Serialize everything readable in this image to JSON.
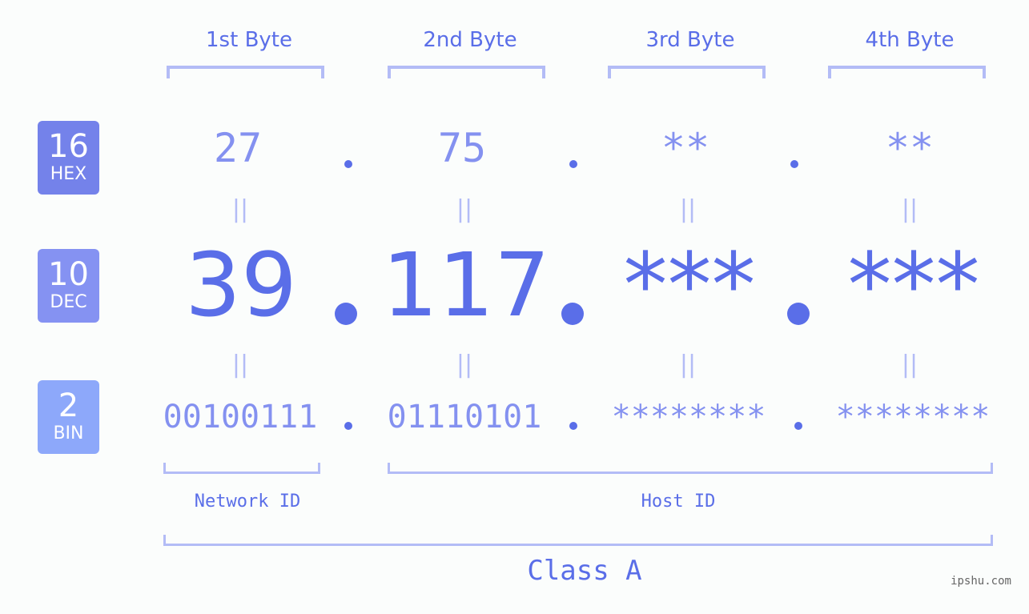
{
  "colors": {
    "accent": "#5a6ee8",
    "light": "#8491f0",
    "bracket": "#b3bcf6",
    "hex_badge": "#7482ea",
    "dec_badge": "#8592f2",
    "bin_badge": "#8da8fa"
  },
  "badges": [
    {
      "num": "16",
      "label": "HEX"
    },
    {
      "num": "10",
      "label": "DEC"
    },
    {
      "num": "2",
      "label": "BIN"
    }
  ],
  "byte_titles": [
    "1st Byte",
    "2nd Byte",
    "3rd Byte",
    "4th Byte"
  ],
  "hex": [
    "27",
    "75",
    "**",
    "**"
  ],
  "dec": [
    "39",
    "117",
    "***",
    "***"
  ],
  "bin": [
    "00100111",
    "01110101",
    "********",
    "********"
  ],
  "equals_sign": "||",
  "network_id_label": "Network ID",
  "host_id_label": "Host ID",
  "class_label": "Class A",
  "watermark": "ipshu.com"
}
